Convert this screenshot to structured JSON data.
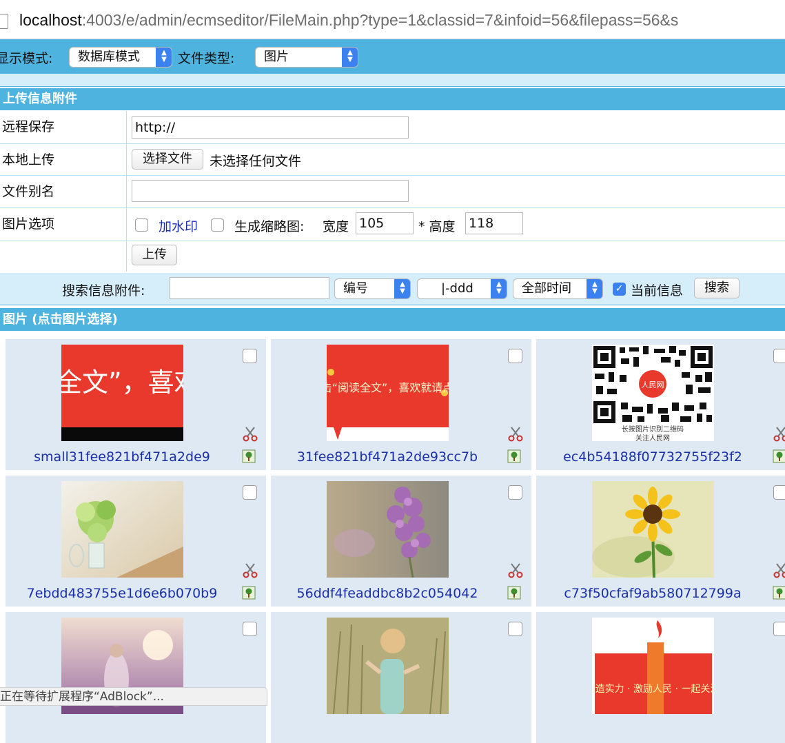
{
  "address_bar": {
    "url_host": "localhost",
    "url_rest": ":4003/e/admin/ecmseditor/FileMain.php?type=1&classid=7&infoid=56&filepass=56&s"
  },
  "mode_bar": {
    "mode_label": "显示模式:",
    "mode_value": "数据库模式",
    "type_label": "文件类型:",
    "type_value": "图片"
  },
  "upload": {
    "title": "上传信息附件",
    "remote_label": "远程保存",
    "remote_value": "http://",
    "local_label": "本地上传",
    "choose_button": "选择文件",
    "no_file_text": "未选择任何文件",
    "alias_label": "文件别名",
    "alias_value": "",
    "image_options_label": "图片选项",
    "watermark_label": "加水印",
    "thumbnail_label": "生成缩略图:",
    "width_label": "宽度",
    "width_value": "105",
    "height_label": "* 高度",
    "height_value": "118",
    "upload_button": "上传"
  },
  "search": {
    "label": "搜索信息附件:",
    "keyword_value": "",
    "field_select": "编号",
    "dir_select": "|-ddd",
    "time_select": "全部时间",
    "current_info_label": "当前信息",
    "current_info_checked": true,
    "search_button": "搜索"
  },
  "gallery": {
    "title": "图片 (点击图片选择)",
    "tiles": [
      {
        "name": "small31fee821bf471a2de9",
        "image": "red-banner-text"
      },
      {
        "name": "31fee821bf471a2de93cc7b",
        "image": "red-banner-full"
      },
      {
        "name": "ec4b54188f07732755f23f2",
        "image": "qr-code",
        "caption1": "长按图片识别二维码",
        "caption2": "关注人民网"
      },
      {
        "name": "7ebdd483755e1d6e6b070b9",
        "image": "green-flowers-vase"
      },
      {
        "name": "56ddf4feaddbc8b2c054042",
        "image": "purple-lilac"
      },
      {
        "name": "c73f50cfaf9ab580712799a",
        "image": "sunflower"
      },
      {
        "name": "",
        "image": "woman-field-purple"
      },
      {
        "name": "",
        "image": "girl-wheat-field"
      },
      {
        "name": "",
        "image": "red-banner-slogan"
      }
    ],
    "banner1_text": "全文”，喜欢",
    "banner2_text": "点击“阅读全文”，喜欢就请点赞",
    "banner3_text": "创造实力 · 激励人民 · 一起关注"
  },
  "status_bar": {
    "text": "正在等待扩展程序“AdBlock”..."
  },
  "colors": {
    "header_blue": "#4fb3e0",
    "light_blue": "#d6eefa",
    "tile_bg": "#dfe9f4",
    "link_blue": "#1a2fa8",
    "select_arrow_blue": "#3b82f0"
  }
}
